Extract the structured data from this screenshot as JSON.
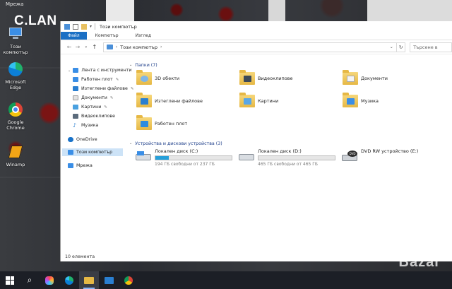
{
  "desktop": {
    "top_label": "Мрежа",
    "brand_text": "C.LAN",
    "icons": [
      {
        "label": "Този компютър",
        "icon": "computer-icon"
      },
      {
        "label": "Microsoft Edge",
        "icon": "edge-icon"
      },
      {
        "label": "Google Chrome",
        "icon": "chrome-icon"
      },
      {
        "label": "Winamp",
        "icon": "winamp-icon"
      }
    ],
    "watermark": "Bazar"
  },
  "window": {
    "title": "Този компютър",
    "ribbon_tabs": [
      "Файл",
      "Компютър",
      "Изглед"
    ],
    "address": {
      "crumb": "Този компютър"
    },
    "search_placeholder": "Търсене в",
    "status": "10 елемента"
  },
  "nav": {
    "quick_access": "Лента с инструменти",
    "pinned": [
      {
        "label": "Работен плот",
        "pinned": true
      },
      {
        "label": "Изтеглени файлове",
        "pinned": true
      },
      {
        "label": "Документи",
        "pinned": true
      },
      {
        "label": "Картини",
        "pinned": true
      },
      {
        "label": "Видеоклипове",
        "pinned": false
      },
      {
        "label": "Музика",
        "pinned": false
      }
    ],
    "onedrive": "OneDrive",
    "this_pc": "Този компютър",
    "network": "Мрежа"
  },
  "folders": {
    "header": "Папки (7)",
    "items": [
      {
        "label": "3D обекти",
        "icon": "3d-objects-icon"
      },
      {
        "label": "Видеоклипове",
        "icon": "videos-folder-icon"
      },
      {
        "label": "Документи",
        "icon": "documents-folder-icon"
      },
      {
        "label": "Изтеглени файлове",
        "icon": "downloads-folder-icon"
      },
      {
        "label": "Картини",
        "icon": "pictures-folder-icon"
      },
      {
        "label": "Музика",
        "icon": "music-folder-icon"
      },
      {
        "label": "Работен плот",
        "icon": "desktop-folder-icon"
      }
    ]
  },
  "devices": {
    "header": "Устройства и дискови устройства (3)",
    "drives": [
      {
        "label": "Локален диск (C:)",
        "free": "194 ГБ свободни от 237 ГБ",
        "used_fraction": 0.18
      },
      {
        "label": "Локален диск (D:)",
        "free": "465 ГБ свободни от 465 ГБ",
        "used_fraction": 0.0
      }
    ],
    "dvd": {
      "label": "DVD RW устройство (E:)"
    }
  },
  "colors": {
    "accent": "#1a6fc4",
    "selection": "#cde3f7",
    "folder": "#e6b845",
    "drive_fill": "#26a0da"
  }
}
